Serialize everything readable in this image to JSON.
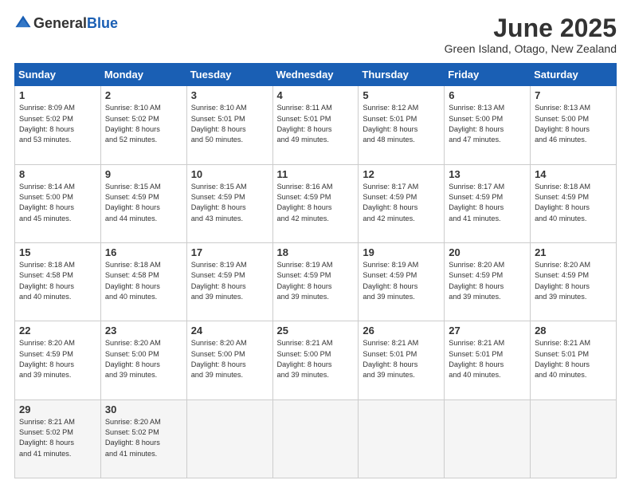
{
  "header": {
    "logo_general": "General",
    "logo_blue": "Blue",
    "month_title": "June 2025",
    "subtitle": "Green Island, Otago, New Zealand"
  },
  "days_of_week": [
    "Sunday",
    "Monday",
    "Tuesday",
    "Wednesday",
    "Thursday",
    "Friday",
    "Saturday"
  ],
  "weeks": [
    [
      {
        "day": "1",
        "info": "Sunrise: 8:09 AM\nSunset: 5:02 PM\nDaylight: 8 hours\nand 53 minutes."
      },
      {
        "day": "2",
        "info": "Sunrise: 8:10 AM\nSunset: 5:02 PM\nDaylight: 8 hours\nand 52 minutes."
      },
      {
        "day": "3",
        "info": "Sunrise: 8:10 AM\nSunset: 5:01 PM\nDaylight: 8 hours\nand 50 minutes."
      },
      {
        "day": "4",
        "info": "Sunrise: 8:11 AM\nSunset: 5:01 PM\nDaylight: 8 hours\nand 49 minutes."
      },
      {
        "day": "5",
        "info": "Sunrise: 8:12 AM\nSunset: 5:01 PM\nDaylight: 8 hours\nand 48 minutes."
      },
      {
        "day": "6",
        "info": "Sunrise: 8:13 AM\nSunset: 5:00 PM\nDaylight: 8 hours\nand 47 minutes."
      },
      {
        "day": "7",
        "info": "Sunrise: 8:13 AM\nSunset: 5:00 PM\nDaylight: 8 hours\nand 46 minutes."
      }
    ],
    [
      {
        "day": "8",
        "info": "Sunrise: 8:14 AM\nSunset: 5:00 PM\nDaylight: 8 hours\nand 45 minutes."
      },
      {
        "day": "9",
        "info": "Sunrise: 8:15 AM\nSunset: 4:59 PM\nDaylight: 8 hours\nand 44 minutes."
      },
      {
        "day": "10",
        "info": "Sunrise: 8:15 AM\nSunset: 4:59 PM\nDaylight: 8 hours\nand 43 minutes."
      },
      {
        "day": "11",
        "info": "Sunrise: 8:16 AM\nSunset: 4:59 PM\nDaylight: 8 hours\nand 42 minutes."
      },
      {
        "day": "12",
        "info": "Sunrise: 8:17 AM\nSunset: 4:59 PM\nDaylight: 8 hours\nand 42 minutes."
      },
      {
        "day": "13",
        "info": "Sunrise: 8:17 AM\nSunset: 4:59 PM\nDaylight: 8 hours\nand 41 minutes."
      },
      {
        "day": "14",
        "info": "Sunrise: 8:18 AM\nSunset: 4:59 PM\nDaylight: 8 hours\nand 40 minutes."
      }
    ],
    [
      {
        "day": "15",
        "info": "Sunrise: 8:18 AM\nSunset: 4:58 PM\nDaylight: 8 hours\nand 40 minutes."
      },
      {
        "day": "16",
        "info": "Sunrise: 8:18 AM\nSunset: 4:58 PM\nDaylight: 8 hours\nand 40 minutes."
      },
      {
        "day": "17",
        "info": "Sunrise: 8:19 AM\nSunset: 4:59 PM\nDaylight: 8 hours\nand 39 minutes."
      },
      {
        "day": "18",
        "info": "Sunrise: 8:19 AM\nSunset: 4:59 PM\nDaylight: 8 hours\nand 39 minutes."
      },
      {
        "day": "19",
        "info": "Sunrise: 8:19 AM\nSunset: 4:59 PM\nDaylight: 8 hours\nand 39 minutes."
      },
      {
        "day": "20",
        "info": "Sunrise: 8:20 AM\nSunset: 4:59 PM\nDaylight: 8 hours\nand 39 minutes."
      },
      {
        "day": "21",
        "info": "Sunrise: 8:20 AM\nSunset: 4:59 PM\nDaylight: 8 hours\nand 39 minutes."
      }
    ],
    [
      {
        "day": "22",
        "info": "Sunrise: 8:20 AM\nSunset: 4:59 PM\nDaylight: 8 hours\nand 39 minutes."
      },
      {
        "day": "23",
        "info": "Sunrise: 8:20 AM\nSunset: 5:00 PM\nDaylight: 8 hours\nand 39 minutes."
      },
      {
        "day": "24",
        "info": "Sunrise: 8:20 AM\nSunset: 5:00 PM\nDaylight: 8 hours\nand 39 minutes."
      },
      {
        "day": "25",
        "info": "Sunrise: 8:21 AM\nSunset: 5:00 PM\nDaylight: 8 hours\nand 39 minutes."
      },
      {
        "day": "26",
        "info": "Sunrise: 8:21 AM\nSunset: 5:01 PM\nDaylight: 8 hours\nand 39 minutes."
      },
      {
        "day": "27",
        "info": "Sunrise: 8:21 AM\nSunset: 5:01 PM\nDaylight: 8 hours\nand 40 minutes."
      },
      {
        "day": "28",
        "info": "Sunrise: 8:21 AM\nSunset: 5:01 PM\nDaylight: 8 hours\nand 40 minutes."
      }
    ],
    [
      {
        "day": "29",
        "info": "Sunrise: 8:21 AM\nSunset: 5:02 PM\nDaylight: 8 hours\nand 41 minutes."
      },
      {
        "day": "30",
        "info": "Sunrise: 8:20 AM\nSunset: 5:02 PM\nDaylight: 8 hours\nand 41 minutes."
      },
      {
        "day": "",
        "info": ""
      },
      {
        "day": "",
        "info": ""
      },
      {
        "day": "",
        "info": ""
      },
      {
        "day": "",
        "info": ""
      },
      {
        "day": "",
        "info": ""
      }
    ]
  ]
}
